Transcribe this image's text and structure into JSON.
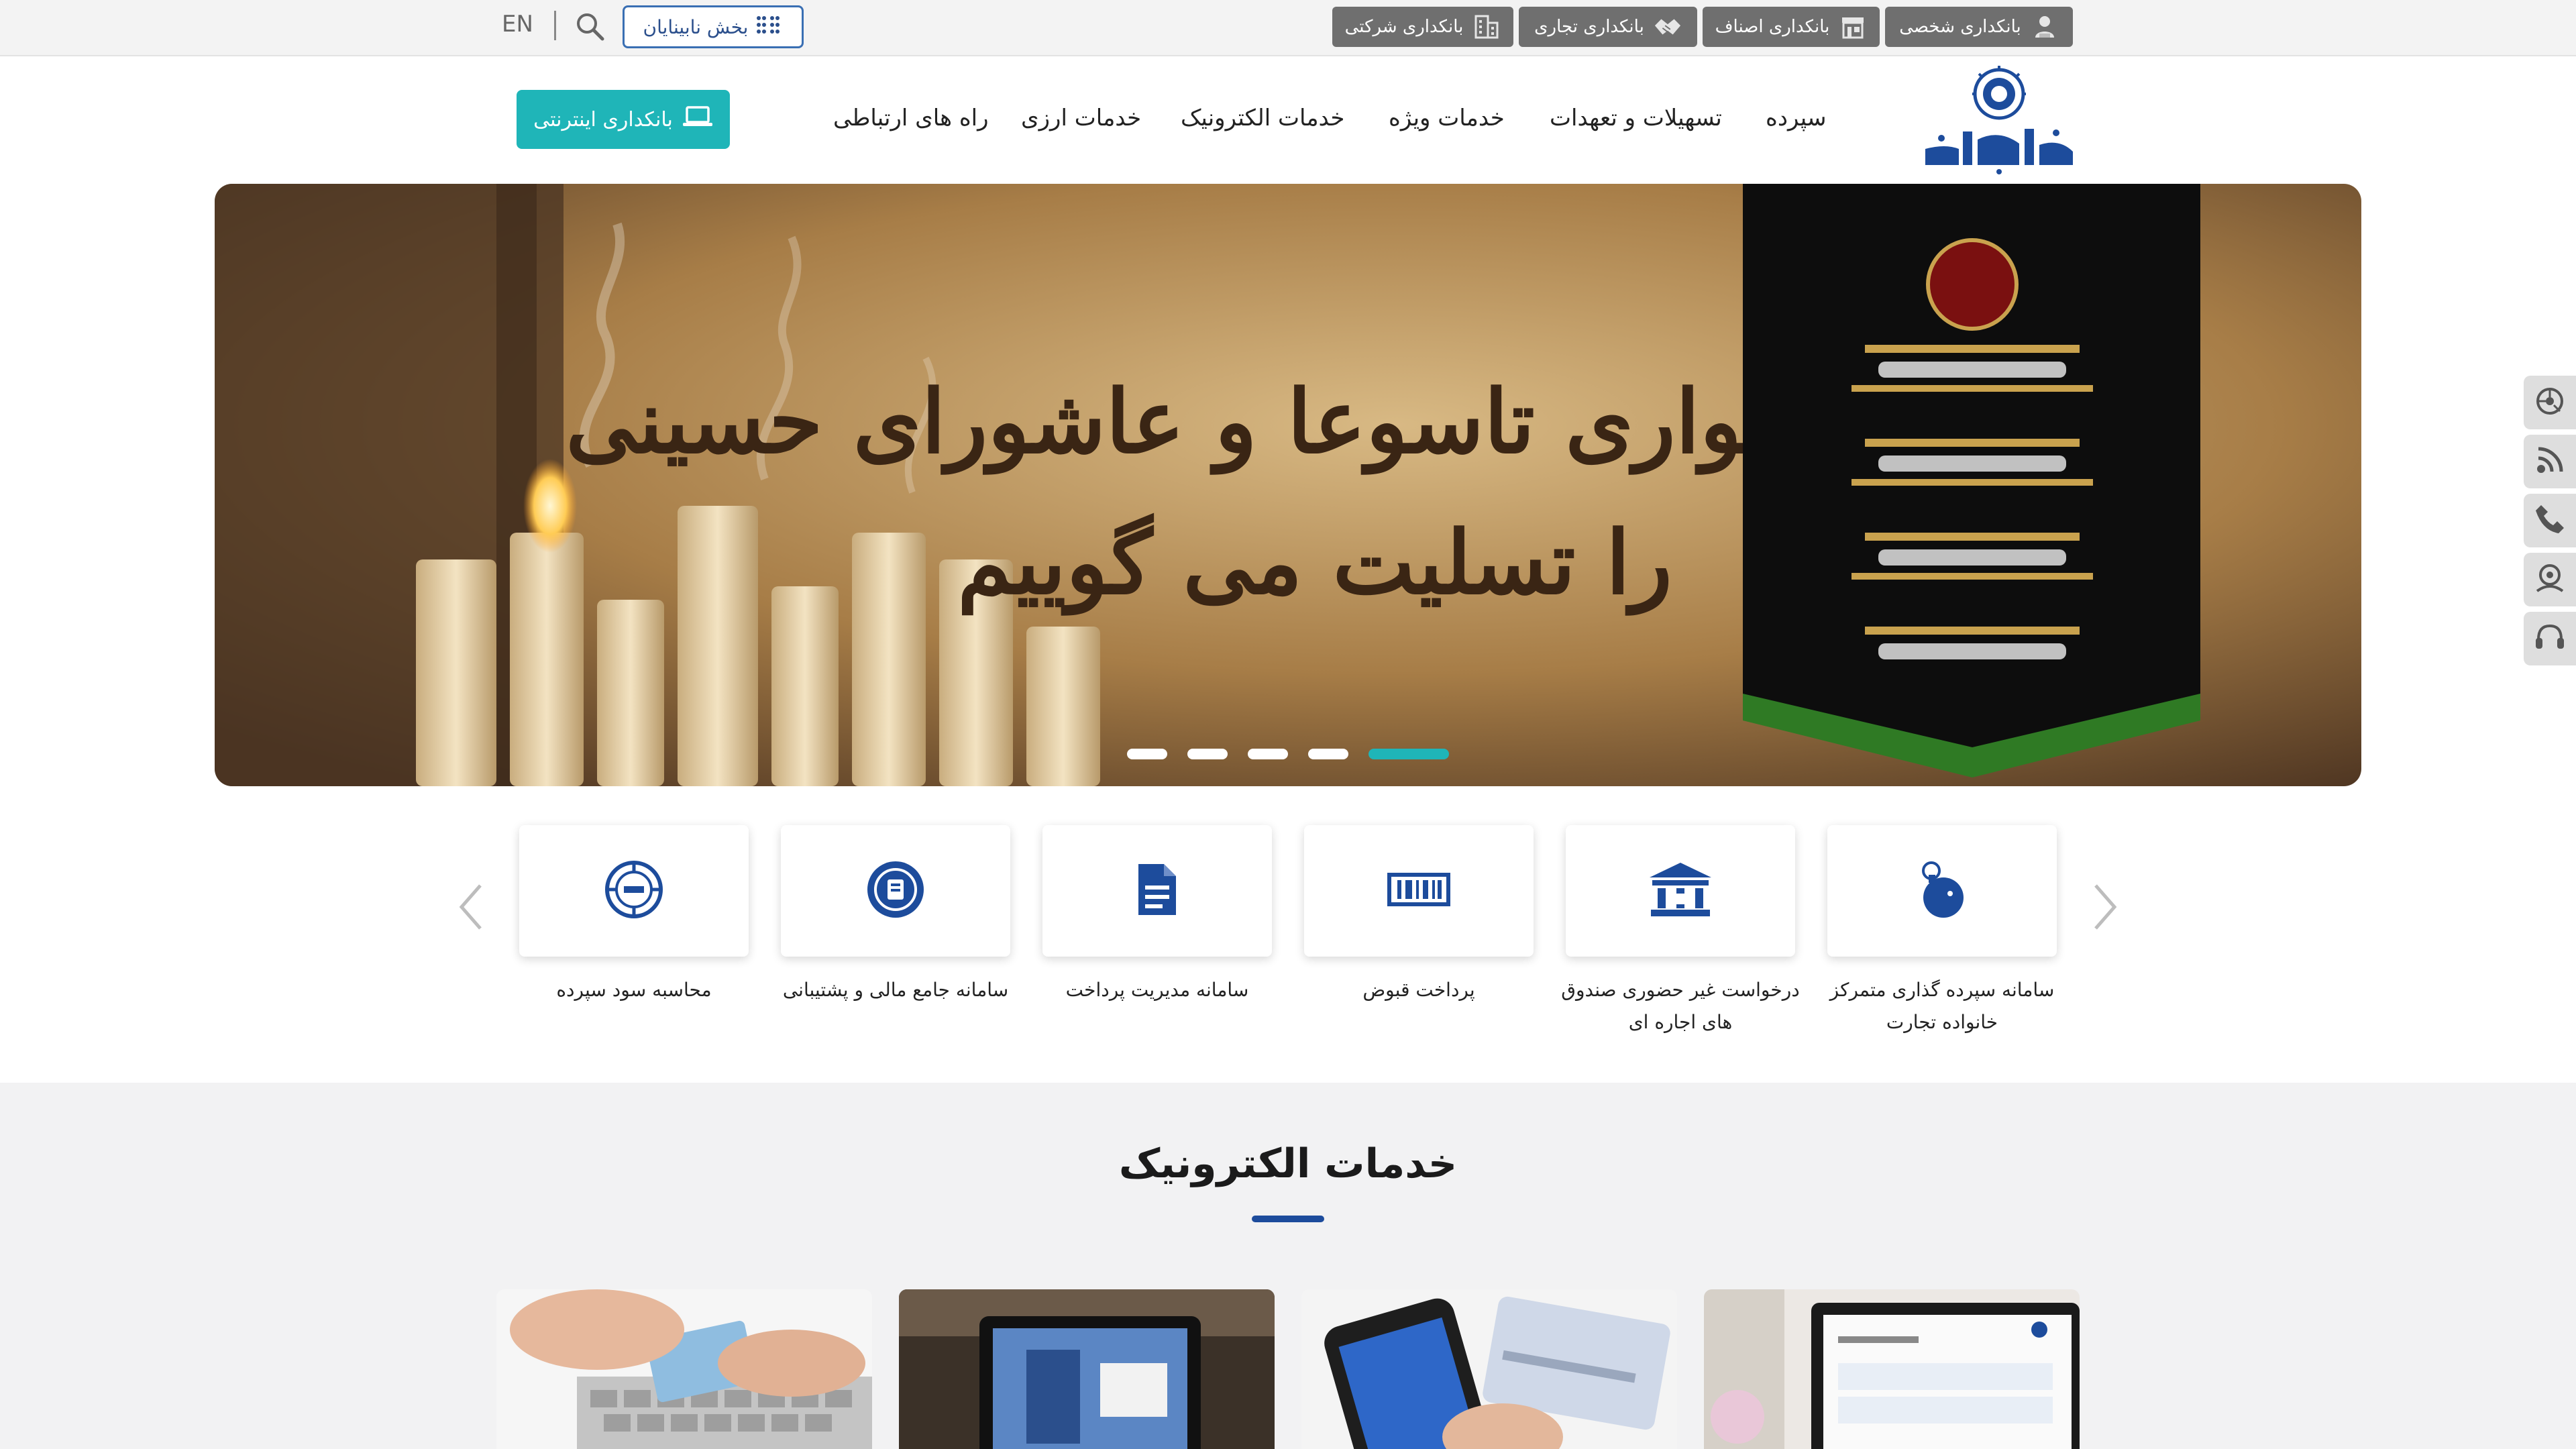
{
  "topbar": {
    "segments": [
      {
        "label": "بانکداری شخصی",
        "icon": "person-icon"
      },
      {
        "label": "بانکداری اصناف",
        "icon": "store-icon"
      },
      {
        "label": "بانکداری تجاری",
        "icon": "handshake-icon"
      },
      {
        "label": "بانکداری شرکتی",
        "icon": "building-icon"
      }
    ],
    "blind_section_label": "بخش نابینایان",
    "language_label": "EN"
  },
  "header": {
    "logo_text": "بانک تجارت",
    "nav": [
      {
        "label": "سپرده"
      },
      {
        "label": "تسهیلات و تعهدات"
      },
      {
        "label": "خدمات ویژه"
      },
      {
        "label": "خدمات الکترونیک"
      },
      {
        "label": "خدمات ارزی"
      },
      {
        "label": "راه های ارتباطی"
      }
    ],
    "internet_banking_label": "بانکداری اینترنتی"
  },
  "banner": {
    "headline_line1": "ایام سوگواری تاسوعا و عاشورای حسینی",
    "headline_line2": "را تسلیت می گوییم",
    "slide_count": 5,
    "active_slide": 1
  },
  "quick_services": [
    {
      "label": "سامانه سپرده گذاری متمرکز خانواده تجارت",
      "icon": "piggy-bank-icon"
    },
    {
      "label": "درخواست غیر حضوری صندوق های اجاره ای",
      "icon": "bank-building-icon"
    },
    {
      "label": "پرداخت قبوض",
      "icon": "bill-barcode-icon"
    },
    {
      "label": "سامانه مدیریت پرداخت",
      "icon": "document-icon"
    },
    {
      "label": "سامانه جامع مالی و پشتیبانی",
      "icon": "finance-support-icon"
    },
    {
      "label": "محاسبه سود سپرده",
      "icon": "calculator-dial-icon"
    }
  ],
  "electronic_services": {
    "title": "خدمات الکترونیک",
    "cards": [
      {
        "image": "laptop-website-photo"
      },
      {
        "image": "mobile-card-photo"
      },
      {
        "image": "tablet-bank-photo"
      },
      {
        "image": "keyboard-card-photo"
      }
    ]
  },
  "side_rail": [
    {
      "icon": "headset-icon"
    },
    {
      "icon": "map-pin-icon"
    },
    {
      "icon": "phone-icon"
    },
    {
      "icon": "rss-icon"
    },
    {
      "icon": "network-icon"
    }
  ],
  "colors": {
    "teal": "#1fb5b8",
    "navy": "#1d4c9c",
    "segment_gray": "#6f6f6f",
    "section_bg": "#f2f2f3"
  }
}
